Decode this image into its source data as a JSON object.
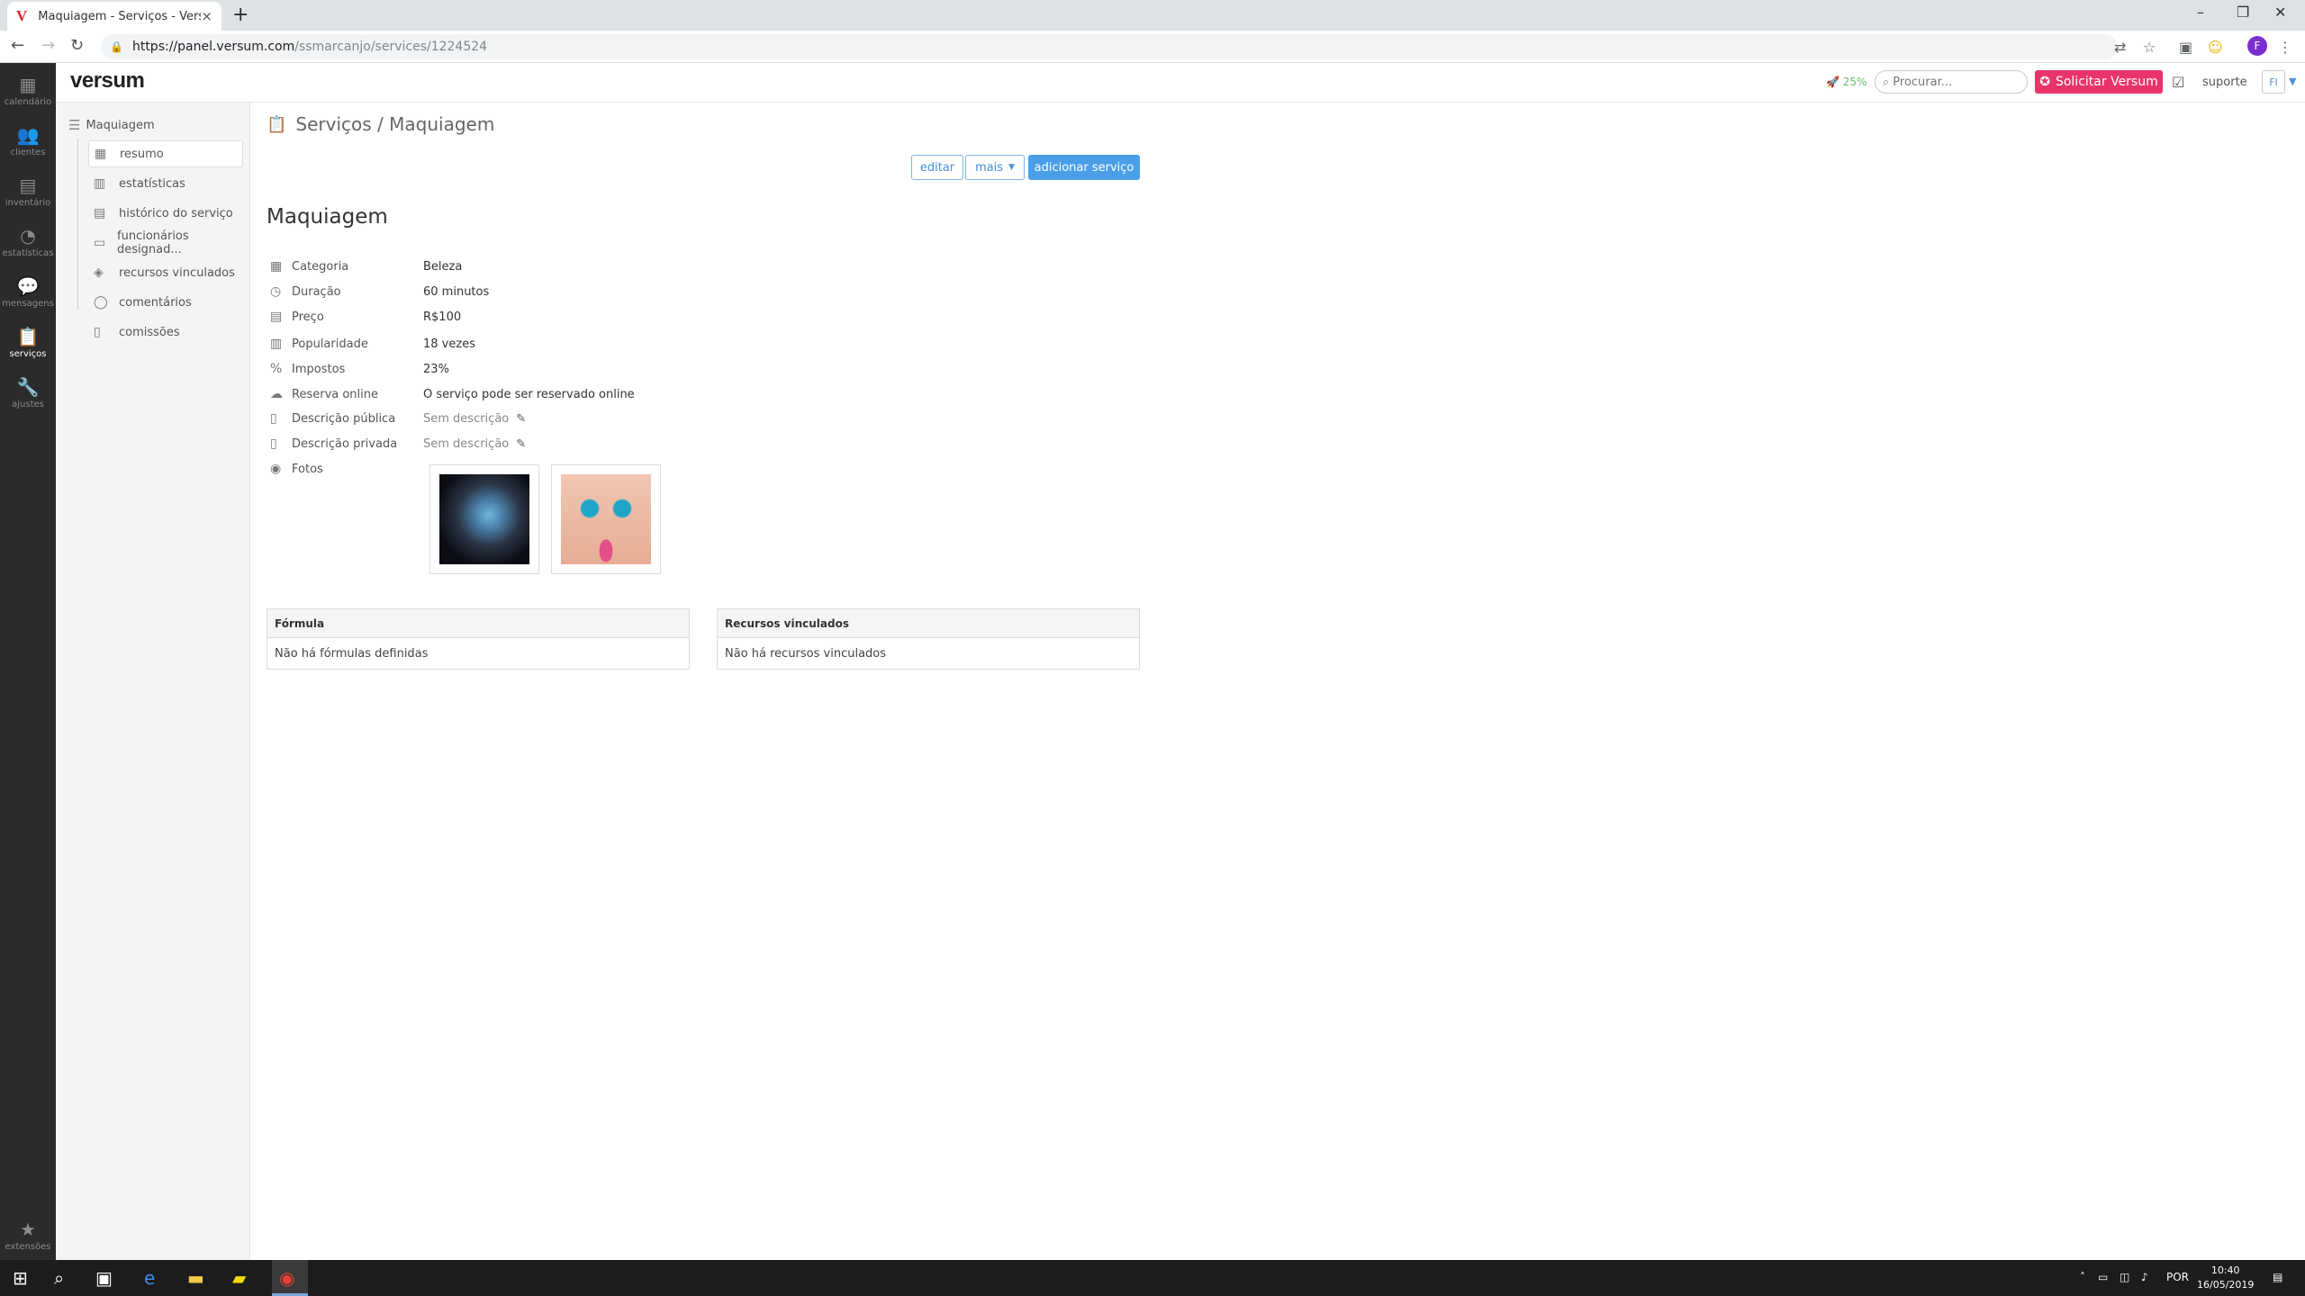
{
  "browser": {
    "tab_title": "Maquiagem - Serviços - Versum",
    "tab_favicon": "V",
    "close_icon": "×",
    "new_tab": "+",
    "url_host": "https://panel.versum.com",
    "url_path": "/ssmarcanjo/services/1224524",
    "profile_initial": "F"
  },
  "leftnav": {
    "items": [
      {
        "label": "calendário",
        "icon": "calendar-icon"
      },
      {
        "label": "clientes",
        "icon": "users-icon"
      },
      {
        "label": "inventário",
        "icon": "inventory-icon"
      },
      {
        "label": "estatísticas",
        "icon": "pie-chart-icon"
      },
      {
        "label": "mensagens",
        "icon": "chat-icon"
      },
      {
        "label": "serviços",
        "icon": "clipboard-icon"
      },
      {
        "label": "ajustes",
        "icon": "wrench-icon"
      }
    ],
    "extensions": "extensões"
  },
  "topbar": {
    "logo": "versum",
    "progress": "25%",
    "search_placeholder": "Procurar...",
    "cta": "Solicitar Versum",
    "support": "suporte",
    "user": "FI"
  },
  "subnav": {
    "root": "Maquiagem",
    "items": [
      {
        "label": "resumo"
      },
      {
        "label": "estatísticas"
      },
      {
        "label": "histórico do serviço"
      },
      {
        "label": "funcionários designad..."
      },
      {
        "label": "recursos vinculados"
      },
      {
        "label": "comentários"
      },
      {
        "label": "comissões"
      }
    ]
  },
  "main": {
    "breadcrumb": "Serviços / Maquiagem",
    "buttons": {
      "edit": "editar",
      "more": "mais",
      "add": "adicionar serviço"
    },
    "title": "Maquiagem",
    "details": [
      {
        "label": "Categoria",
        "value": "Beleza"
      },
      {
        "label": "Duração",
        "value": "60 minutos"
      },
      {
        "label": "Preço",
        "value": "R$100"
      },
      {
        "label": "Popularidade",
        "value": "18 vezes"
      },
      {
        "label": "Impostos",
        "value": "23%"
      },
      {
        "label": "Reserva online",
        "value": "O serviço pode ser reservado online"
      },
      {
        "label": "Descrição pública",
        "value": "Sem descrição"
      },
      {
        "label": "Descrição privada",
        "value": "Sem descrição"
      },
      {
        "label": "Fotos",
        "value": ""
      }
    ],
    "formula": {
      "title": "Fórmula",
      "empty": "Não há fórmulas definidas"
    },
    "resources": {
      "title": "Recursos vinculados",
      "empty": "Não há recursos vinculados"
    }
  },
  "taskbar": {
    "lang": "POR",
    "time": "10:40",
    "date": "16/05/2019"
  },
  "colors": {
    "accent": "#4a9ee8",
    "cta": "#e8336b",
    "sidebar": "#2b2b2b"
  }
}
